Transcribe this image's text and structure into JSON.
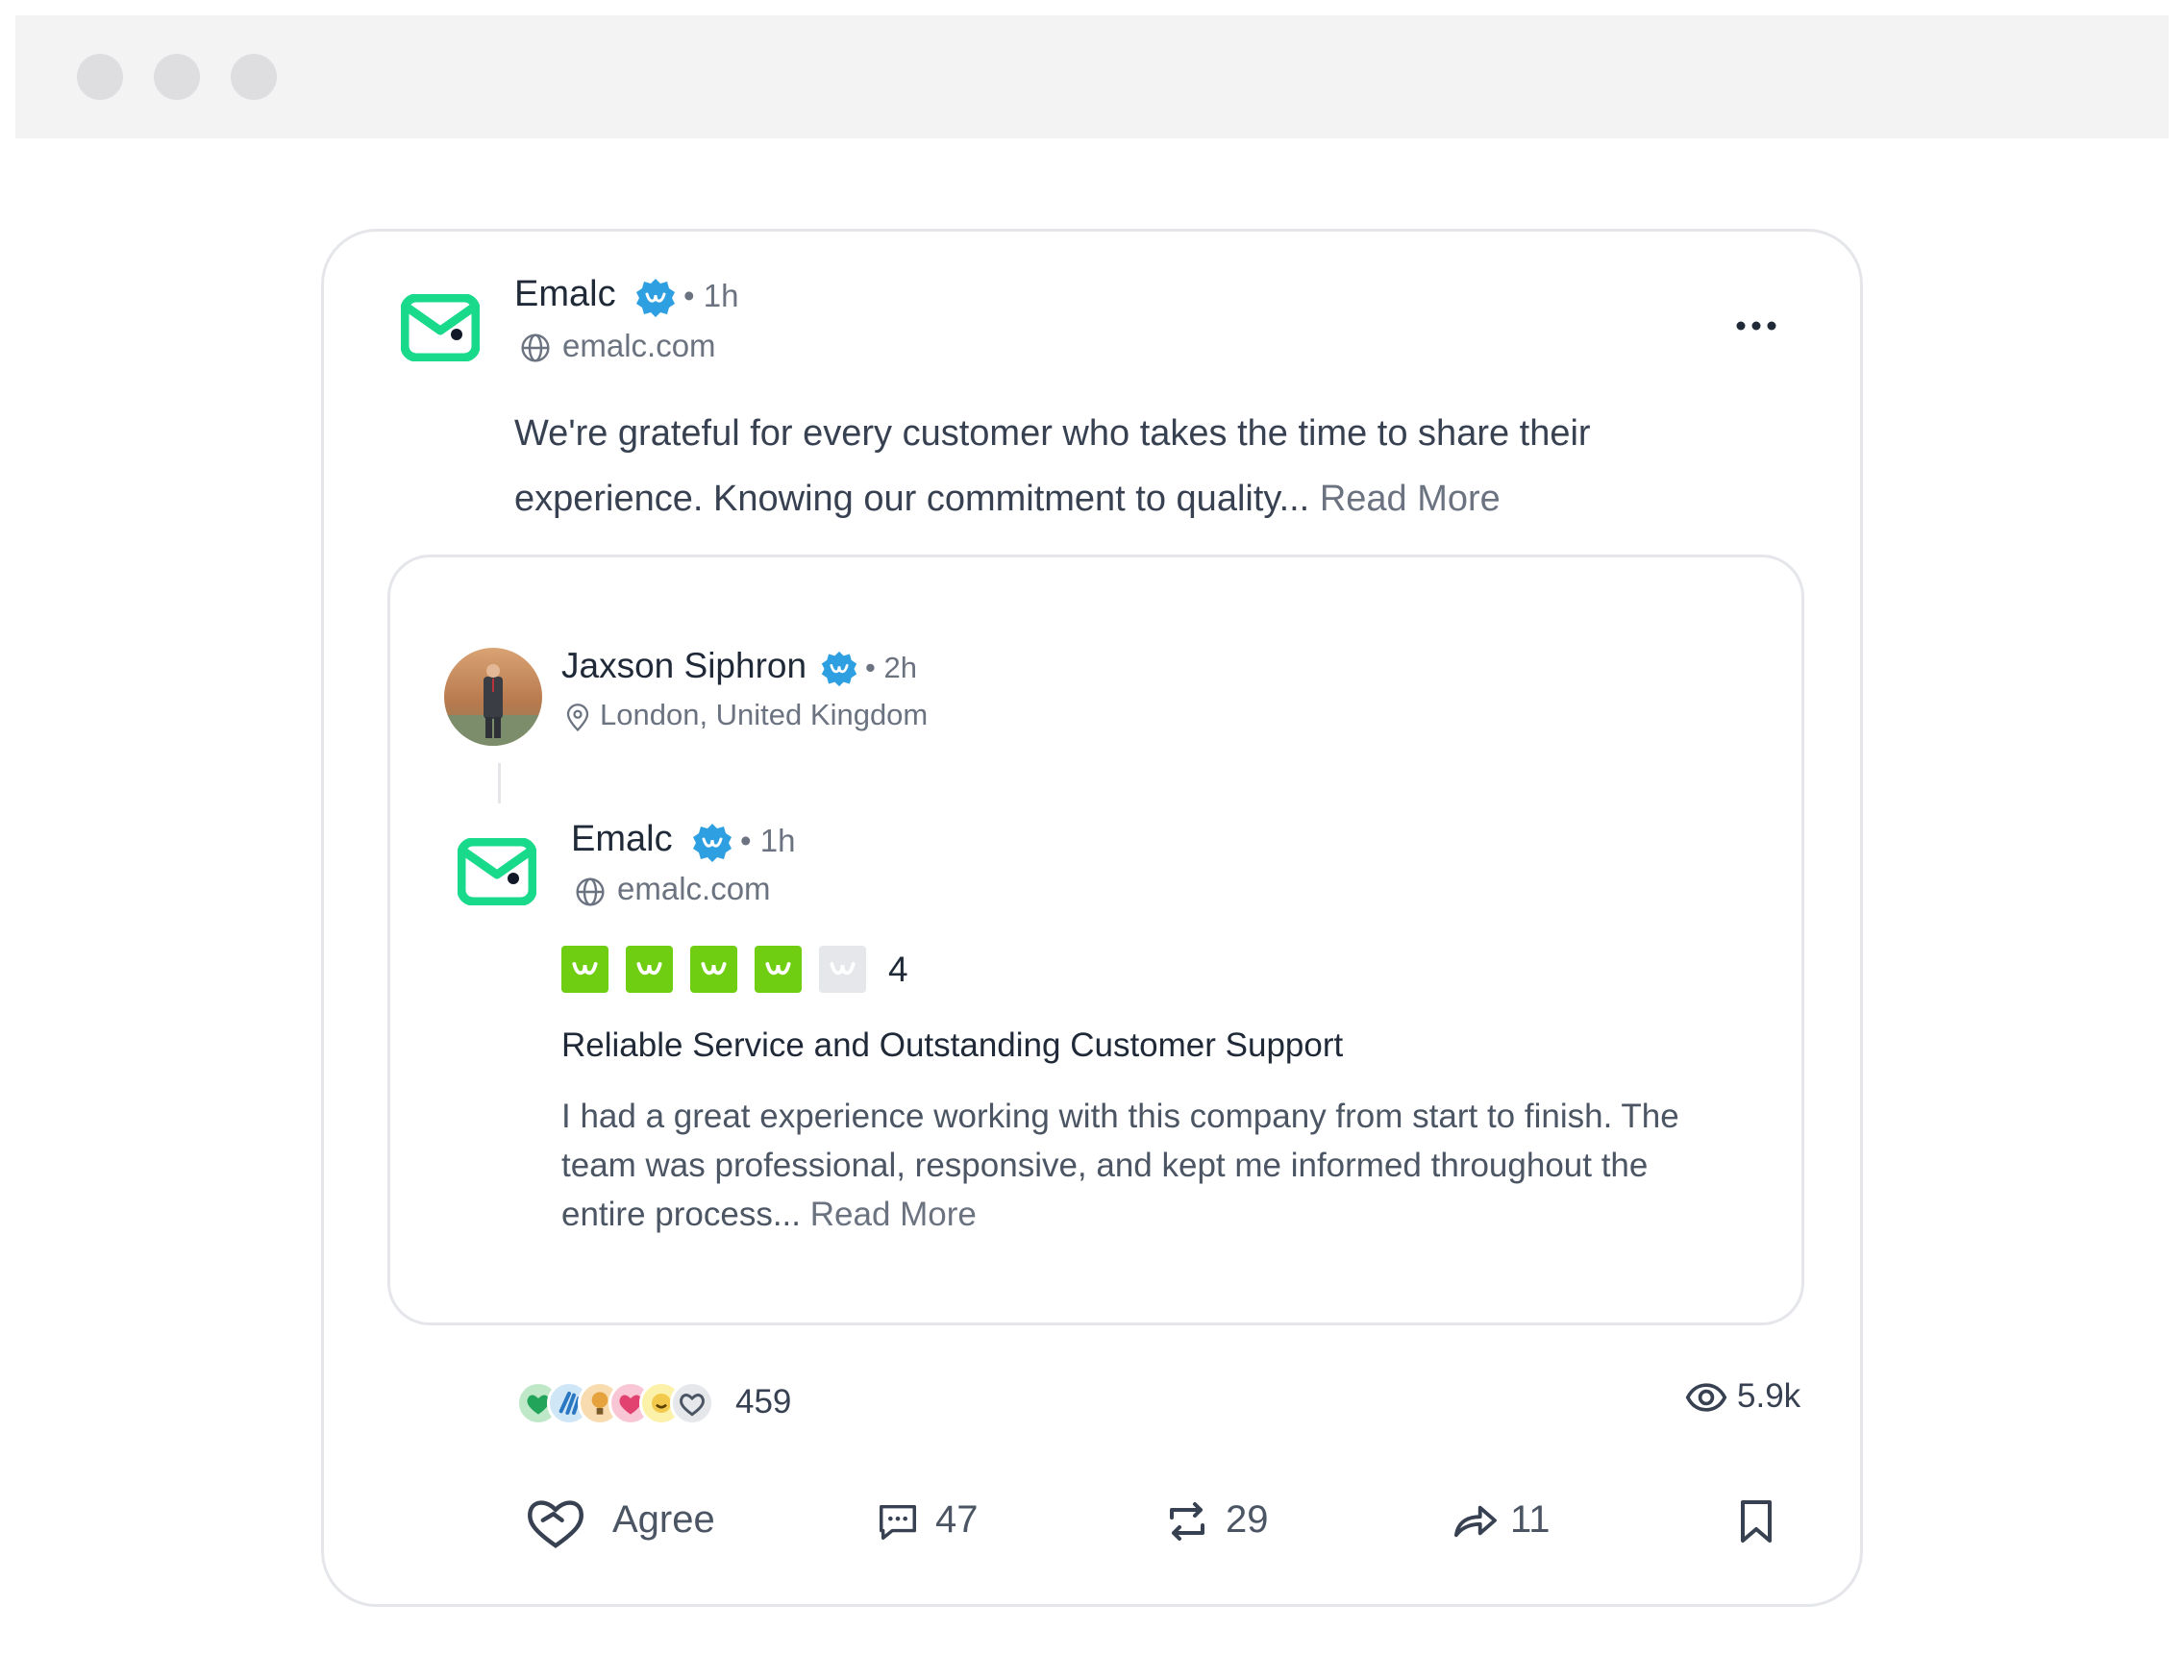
{
  "window": {
    "controls": [
      "close",
      "minimize",
      "maximize"
    ]
  },
  "post": {
    "author": "Emalc",
    "time": "1h",
    "website": "emalc.com",
    "text": "We're grateful for every customer who takes the time to share their experience. Knowing our commitment to quality...",
    "text_line1": "We're grateful for every customer who takes the time to share their",
    "text_line2": "experience. Knowing our commitment to quality...",
    "read_more": "Read More"
  },
  "review": {
    "reviewer": "Jaxson Siphron",
    "reviewer_time": "2h",
    "location": "London, United Kingdom",
    "company": "Emalc",
    "company_time": "1h",
    "company_website": "emalc.com",
    "rating": "4",
    "rating_value": 4,
    "rating_max": 5,
    "title": "Reliable Service and Outstanding Customer Support",
    "body_line1": "I had a great experience working with this company from start to finish. The",
    "body_line2": "team was professional, responsive, and kept me informed throughout the",
    "body_line3": "entire process...",
    "read_more": "Read More"
  },
  "stats": {
    "reactions_count": "459",
    "views": "5.9k"
  },
  "actions": {
    "agree_label": "Agree",
    "comments": "47",
    "reposts": "29",
    "shares": "11"
  },
  "colors": {
    "brand_green": "#19d98b",
    "verified_blue": "#2e9fe0",
    "star_green": "#6fce12",
    "star_empty": "#e5e7eb"
  }
}
